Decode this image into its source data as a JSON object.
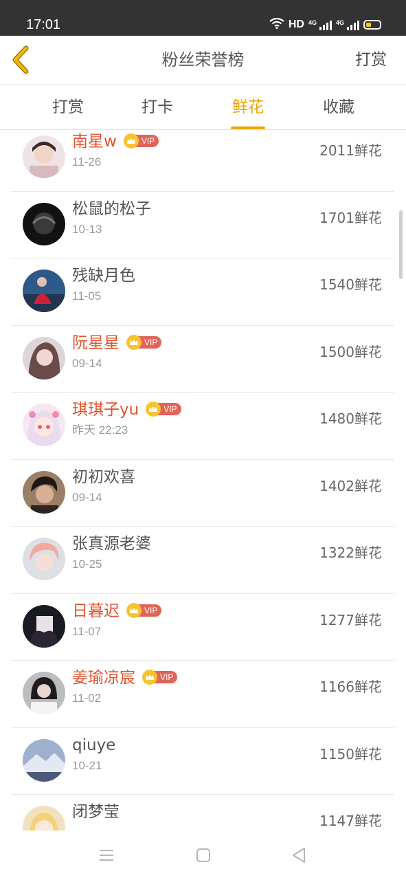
{
  "status_bar": {
    "time": "17:01",
    "network_label": "HD",
    "signal_labels": [
      "4G",
      "4G"
    ],
    "battery_color": "#f5c518"
  },
  "header": {
    "back_icon": "chevron-left-icon",
    "title": "粉丝荣誉榜",
    "action": "打赏",
    "back_color": "#f0a300"
  },
  "tabs": [
    {
      "label": "打赏",
      "active": false
    },
    {
      "label": "打卡",
      "active": false
    },
    {
      "label": "鲜花",
      "active": true
    },
    {
      "label": "收藏",
      "active": false
    }
  ],
  "accent_color": "#f0a300",
  "vip_name_color": "#e0542f",
  "vip_badge_text": "VIP",
  "fans": [
    {
      "name": "南星w",
      "vip": true,
      "date": "11-26",
      "count": "2011鲜花"
    },
    {
      "name": "松鼠的松子",
      "vip": false,
      "date": "10-13",
      "count": "1701鲜花"
    },
    {
      "name": "残缺月色",
      "vip": false,
      "date": "11-05",
      "count": "1540鲜花"
    },
    {
      "name": "阮星星",
      "vip": true,
      "date": "09-14",
      "count": "1500鲜花"
    },
    {
      "name": "琪琪子yu",
      "vip": true,
      "date": "昨天 22:23",
      "count": "1480鲜花"
    },
    {
      "name": "初初欢喜",
      "vip": false,
      "date": "09-14",
      "count": "1402鲜花"
    },
    {
      "name": "张真源老婆",
      "vip": false,
      "date": "10-25",
      "count": "1322鲜花"
    },
    {
      "name": "日暮迟",
      "vip": true,
      "date": "11-07",
      "count": "1277鲜花"
    },
    {
      "name": "姜瑜凉宸",
      "vip": true,
      "date": "11-02",
      "count": "1166鲜花"
    },
    {
      "name": "qiuye",
      "vip": false,
      "date": "10-21",
      "count": "1150鲜花"
    },
    {
      "name": "闭梦莹",
      "vip": false,
      "date": "",
      "count": "1147鲜花"
    }
  ],
  "nav_bar": {
    "menu_icon": "menu-icon",
    "home_icon": "home-square-icon",
    "back_icon": "back-triangle-icon"
  }
}
